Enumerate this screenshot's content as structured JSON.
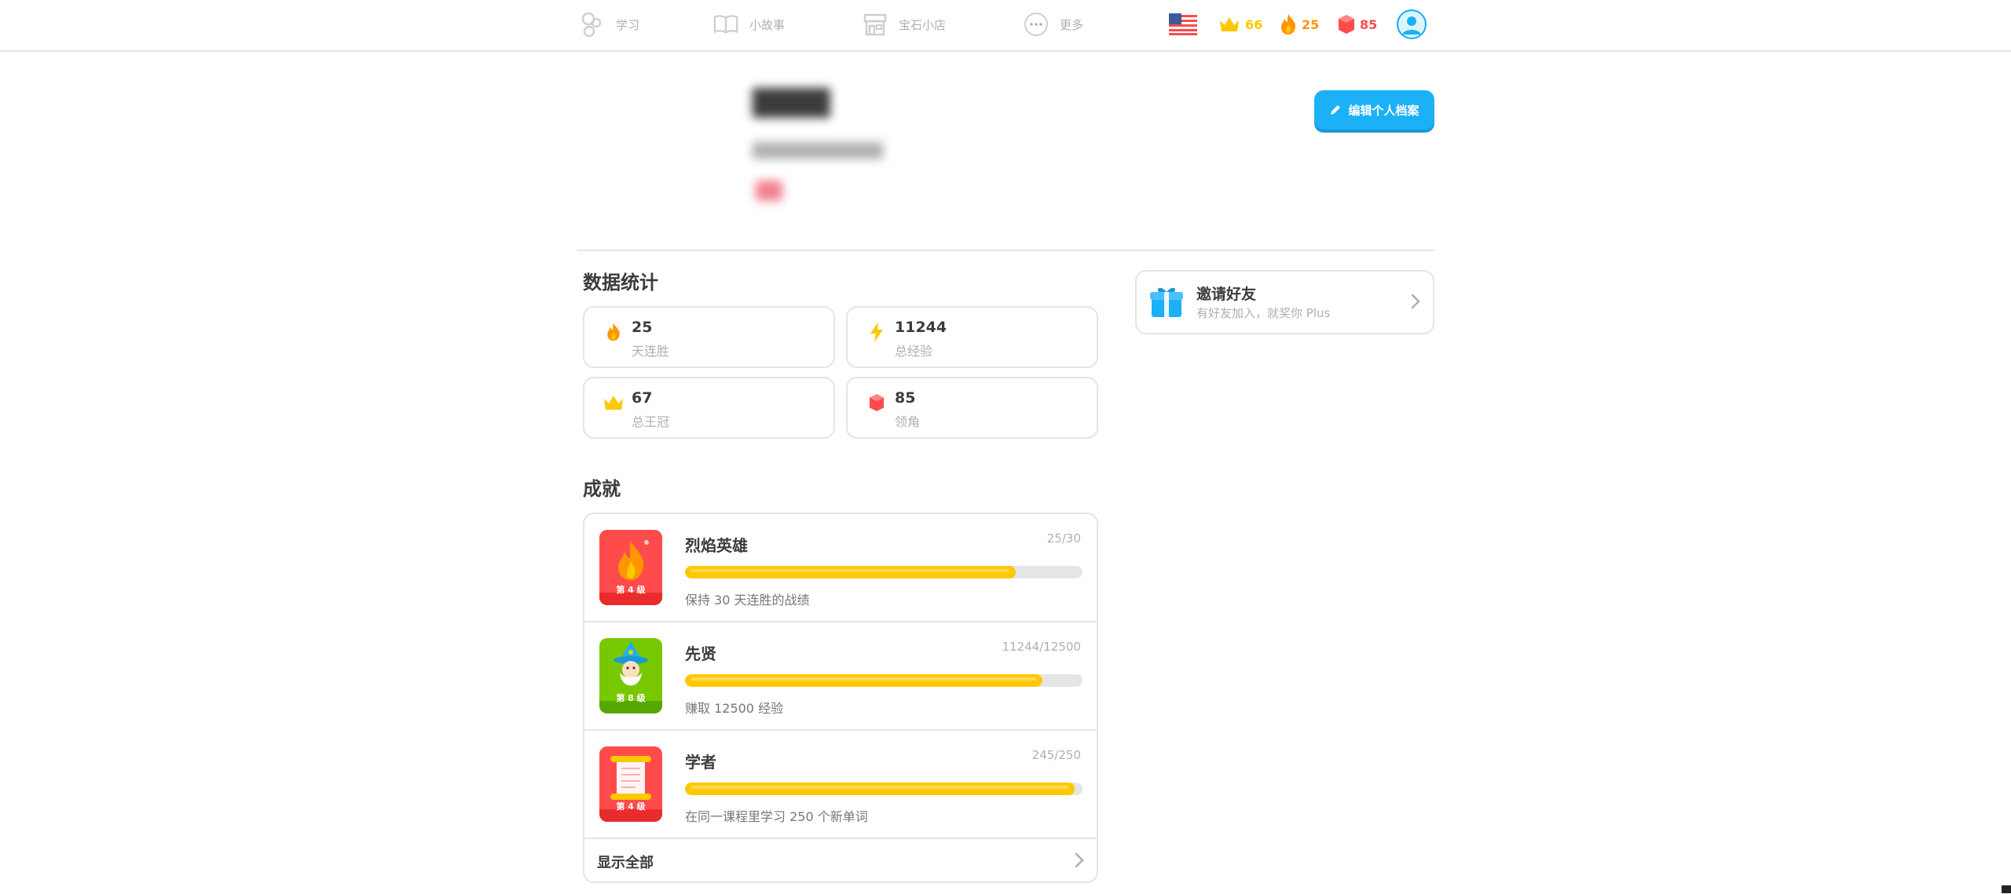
{
  "nav": {
    "items": [
      {
        "label": "学习",
        "icon": "learn-icon"
      },
      {
        "label": "小故事",
        "icon": "book-icon"
      },
      {
        "label": "宝石小店",
        "icon": "shop-icon"
      },
      {
        "label": "更多",
        "icon": "more-icon"
      }
    ],
    "crowns": "66",
    "streak": "25",
    "gems": "85"
  },
  "profile": {
    "edit_label": "编辑个人档案"
  },
  "stats": {
    "title": "数据统计",
    "cards": [
      {
        "value": "25",
        "label": "天连胜",
        "icon": "fire-icon"
      },
      {
        "value": "11244",
        "label": "总经验",
        "icon": "lightning-icon"
      },
      {
        "value": "67",
        "label": "总王冠",
        "icon": "crown-icon"
      },
      {
        "value": "85",
        "label": "领角",
        "icon": "gem-icon"
      }
    ]
  },
  "invite": {
    "title": "邀请好友",
    "subtitle": "有好友加入，就奖你 Plus"
  },
  "achievements": {
    "title": "成就",
    "items": [
      {
        "title": "烈焰英雄",
        "progress_text": "25/30",
        "progress": 0.833,
        "desc": "保持 30 天连胜的战绩",
        "level": "第 4 级",
        "color": "#ff4b4b"
      },
      {
        "title": "先贤",
        "progress_text": "11244/12500",
        "progress": 0.8995,
        "desc": "赚取 12500 经验",
        "level": "第 8 级",
        "color": "#78c800"
      },
      {
        "title": "学者",
        "progress_text": "245/250",
        "progress": 0.98,
        "desc": "在同一课程里学习 250 个新单词",
        "level": "第 4 级",
        "color": "#ff4b4b"
      }
    ],
    "show_all": "显示全部"
  },
  "colors": {
    "accent": "#1cb0f6",
    "crown": "#ffc800",
    "streak": "#ff9600",
    "gem": "#ff4b4b",
    "border": "#e5e5e5"
  }
}
